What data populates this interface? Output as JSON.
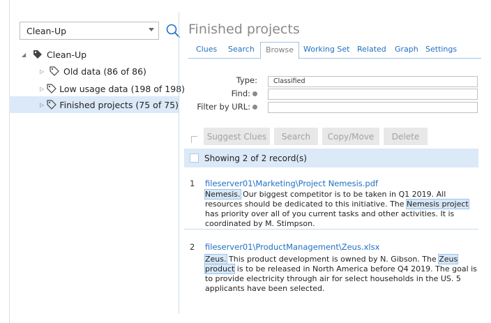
{
  "left": {
    "dropdown_value": "Clean-Up",
    "tree": [
      {
        "label": "Clean-Up",
        "expanded": true,
        "selected": false
      },
      {
        "label": "Old data (86 of 86)",
        "expanded": false,
        "selected": false
      },
      {
        "label": "Low usage data (198 of 198)",
        "expanded": false,
        "selected": false
      },
      {
        "label": "Finished projects (75 of 75)",
        "expanded": false,
        "selected": true
      }
    ]
  },
  "main": {
    "title": "Finished projects",
    "tabs": [
      "Clues",
      "Search",
      "Browse",
      "Working Set",
      "Related",
      "Graph",
      "Settings"
    ],
    "active_tab": "Browse",
    "filters": {
      "type_label": "Type:",
      "type_value": "Classified",
      "find_label": "Find:",
      "find_value": "",
      "url_label": "Filter by URL:",
      "url_value": ""
    },
    "buttons": {
      "suggest": "Suggest Clues",
      "search": "Search",
      "copy_move": "Copy/Move",
      "delete": "Delete"
    },
    "showing": "Showing 2 of 2 record(s)",
    "records": [
      {
        "num": "1",
        "path": "fileserver01\\Marketing\\Project Nemesis.pdf",
        "hl1": "Nemesis.",
        "text1": " Our biggest competitor is to be taken in Q1 2019. All resources should be dedicated to this initiative. The ",
        "hl2": "Nemesis project",
        "text2": " has priority over all of you current tasks and other activities. It is coordinated by M. Stimpson."
      },
      {
        "num": "2",
        "path": "fileserver01\\ProductManagement\\Zeus.xlsx",
        "hl1": "Zeus.",
        "text1": " This product development is owned by N. Gibson. The ",
        "hl2": "Zeus product",
        "text2": " is to be released in North America before Q4 2019. The goal is to provide electricity through air for select households in the US. 5 applicants have been selected."
      }
    ]
  },
  "colors": {
    "accent": "#1f70c1",
    "selection": "#dbe9f8",
    "highlight": "#d6e7f7",
    "disabled_button": "#e8e8e8"
  },
  "icons": {
    "search": "magnifier-icon",
    "tag": "tag-icon",
    "tag_filled": "tag-filled-icon",
    "info": "info-dot-icon"
  }
}
